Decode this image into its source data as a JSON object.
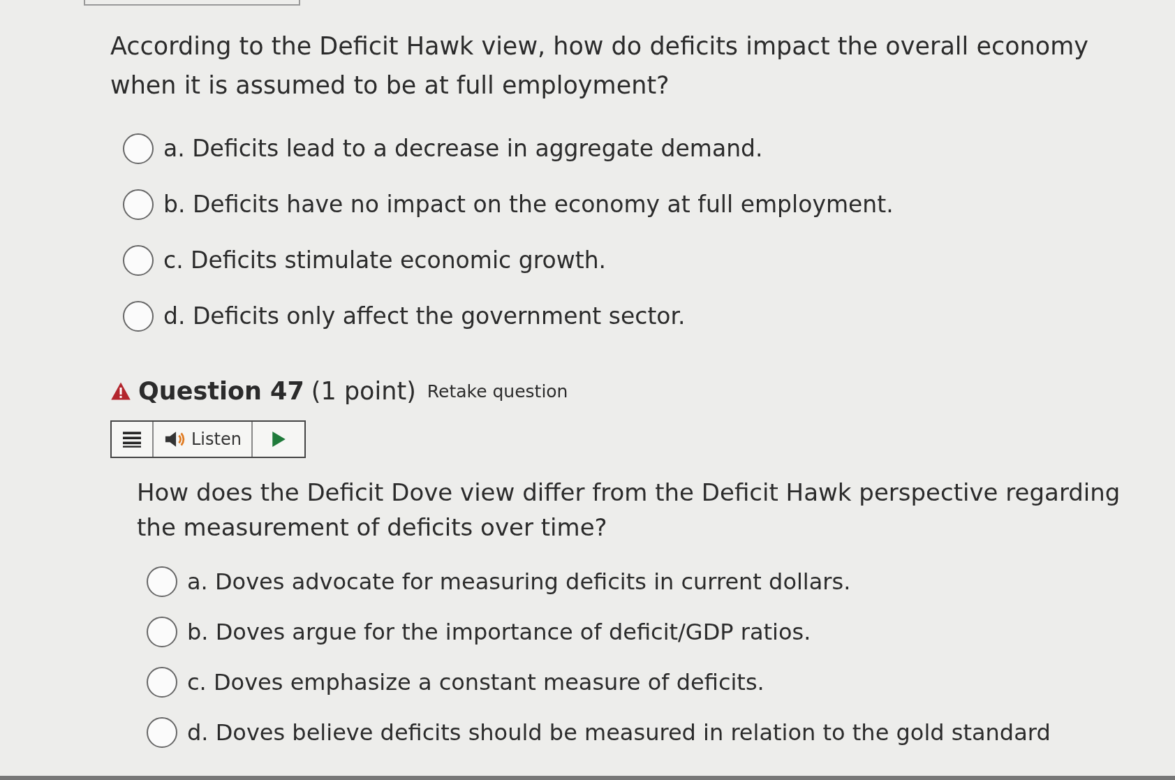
{
  "question_1": {
    "prompt": "According to the Deficit Hawk view, how do deficits impact the overall economy when it is assumed to be at full employment?",
    "options": [
      {
        "label": "a. Deficits lead to a decrease in aggregate demand.",
        "selected": false
      },
      {
        "label": "b. Deficits have no impact on the economy at full employment.",
        "selected": false
      },
      {
        "label": "c. Deficits stimulate economic growth.",
        "selected": false
      },
      {
        "label": "d. Deficits only affect the government sector.",
        "selected": false
      }
    ]
  },
  "question_2": {
    "title": "Question 47",
    "points": "(1 point)",
    "retake": "Retake question",
    "warning": true,
    "listen": {
      "label": "Listen"
    },
    "prompt": "How does the Deficit Dove view differ from the Deficit Hawk perspective regarding the measurement of deficits over time?",
    "options": [
      {
        "label": "a. Doves advocate for measuring deficits in current dollars.",
        "selected": false
      },
      {
        "label": "b. Doves argue for the importance of deficit/GDP ratios.",
        "selected": false
      },
      {
        "label": "c. Doves emphasize a constant measure of deficits.",
        "selected": false
      },
      {
        "label": "d. Doves believe deficits should be measured in relation to the gold standard",
        "selected": false
      }
    ]
  }
}
